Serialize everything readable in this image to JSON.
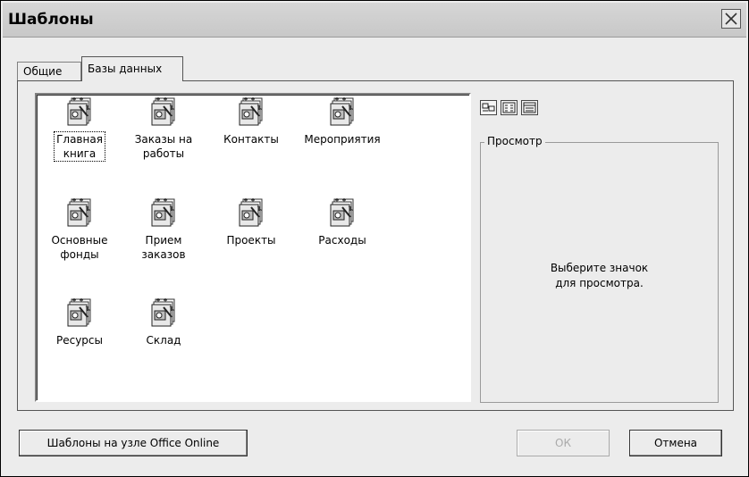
{
  "window": {
    "title": "Шаблоны"
  },
  "tabs": [
    {
      "label": "Общие",
      "active": false
    },
    {
      "label": "Базы данных",
      "active": true
    }
  ],
  "templates": [
    {
      "label": "Главная\nкнига",
      "selected": true,
      "icon": "database-template-icon"
    },
    {
      "label": "Заказы на\nработы",
      "selected": false,
      "icon": "database-template-icon"
    },
    {
      "label": "Контакты",
      "selected": false,
      "icon": "database-template-icon"
    },
    {
      "label": "Мероприятия",
      "selected": false,
      "icon": "database-template-icon"
    },
    {
      "label": "Основные\nфонды",
      "selected": false,
      "icon": "database-template-icon"
    },
    {
      "label": "Прием\nзаказов",
      "selected": false,
      "icon": "database-template-icon"
    },
    {
      "label": "Проекты",
      "selected": false,
      "icon": "database-template-icon"
    },
    {
      "label": "Расходы",
      "selected": false,
      "icon": "database-template-icon"
    },
    {
      "label": "Ресурсы",
      "selected": false,
      "icon": "database-template-icon"
    },
    {
      "label": "Склад",
      "selected": false,
      "icon": "database-template-icon"
    }
  ],
  "view_buttons": [
    {
      "name": "large-icons-view-icon",
      "selected": true
    },
    {
      "name": "list-view-icon",
      "selected": false
    },
    {
      "name": "details-view-icon",
      "selected": false
    }
  ],
  "preview": {
    "label": "Просмотр",
    "hint": "Выберите значок\nдля просмотра."
  },
  "buttons": {
    "online_label": "Шаблоны на узле Office Online",
    "ok_label": "ОК",
    "ok_enabled": false,
    "cancel_label": "Отмена"
  }
}
